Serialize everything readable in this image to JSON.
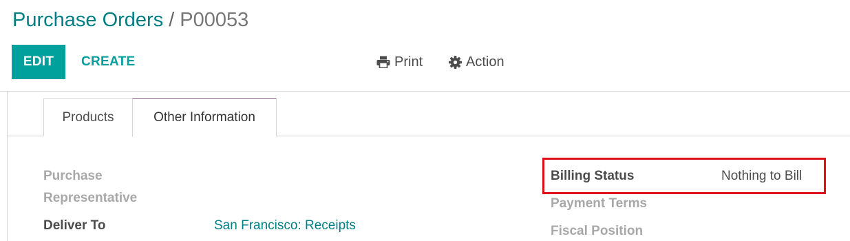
{
  "breadcrumb": {
    "parent": "Purchase Orders",
    "separator": "/",
    "current": "P00053"
  },
  "buttons": {
    "edit": "EDIT",
    "create": "CREATE",
    "print": "Print",
    "action": "Action"
  },
  "tabs": [
    {
      "label": "Products",
      "active": false
    },
    {
      "label": "Other Information",
      "active": true
    }
  ],
  "fields": {
    "purchase_representative_label_line1": "Purchase",
    "purchase_representative_label_line2": "Representative",
    "deliver_to_label": "Deliver To",
    "deliver_to_value": "San Francisco: Receipts",
    "billing_status_label": "Billing Status",
    "billing_status_value": "Nothing to Bill",
    "payment_terms_label": "Payment Terms",
    "fiscal_position_label": "Fiscal Position"
  },
  "colors": {
    "primary": "#00a09d",
    "link": "#017e84",
    "highlight": "#e0101a"
  },
  "icons": {
    "print": "print-icon",
    "action": "gear-icon"
  }
}
